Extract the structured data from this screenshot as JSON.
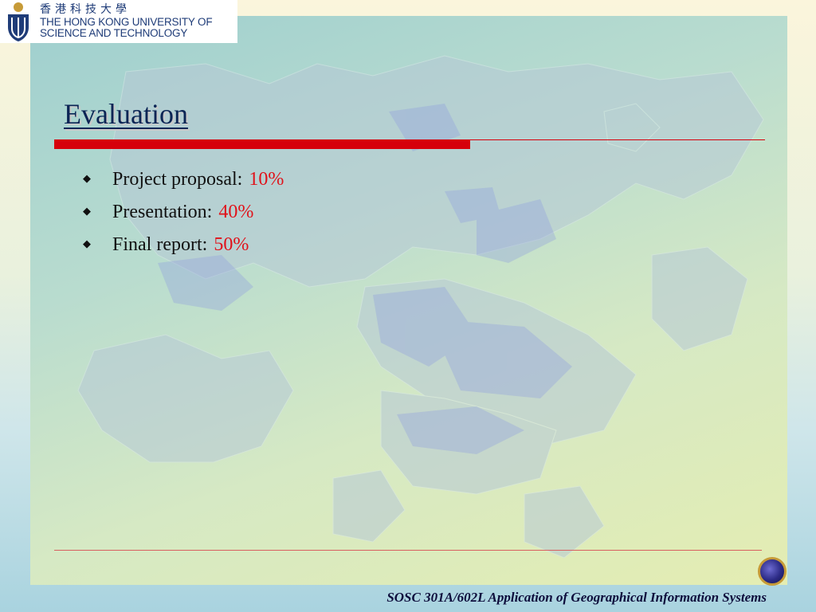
{
  "logo": {
    "chinese": "香港科技大學",
    "line1": "THE HONG KONG UNIVERSITY OF",
    "line2": "SCIENCE AND TECHNOLOGY"
  },
  "slide": {
    "title": "Evaluation",
    "bullets": [
      {
        "label": "Project proposal:",
        "value": "10%"
      },
      {
        "label": "Presentation:",
        "value": "40%"
      },
      {
        "label": "Final report:",
        "value": "50%"
      }
    ]
  },
  "footer": {
    "course": "SOSC 301A/602L Application of Geographical Information Systems"
  },
  "colors": {
    "title": "#0b2555",
    "accent_red": "#d6000b",
    "value_red": "#e0121a",
    "logo_blue": "#1f3c78"
  },
  "icons": {
    "bullet": "diamond-icon",
    "logo": "hkust-logo-icon",
    "seal": "university-seal-icon"
  }
}
